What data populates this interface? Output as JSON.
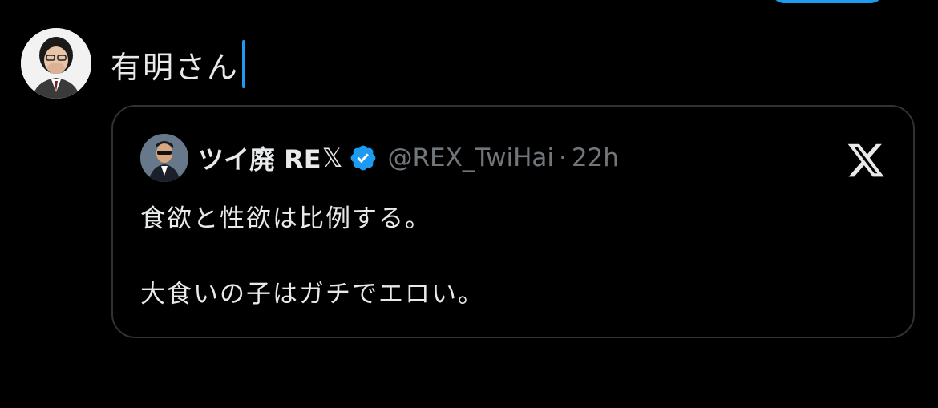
{
  "colors": {
    "background": "#000000",
    "primary_text": "#e7e9ea",
    "secondary_text": "#71767b",
    "card_border": "#2f3336",
    "accent_blue": "#1d9bf0",
    "caret": "#1d9bf0"
  },
  "compose": {
    "text": "有明さん",
    "avatar_icon": "user-avatar-icon"
  },
  "quote": {
    "display_name": "ツイ廃 RE",
    "name_glyph": "𝕏",
    "verified_icon": "verified-badge-icon",
    "handle": "@REX_TwiHai",
    "separator": "·",
    "timestamp": "22h",
    "platform_icon": "x-logo-icon",
    "lines": [
      "食欲と性欲は比例する。",
      "大食いの子はガチでエロい。"
    ]
  }
}
